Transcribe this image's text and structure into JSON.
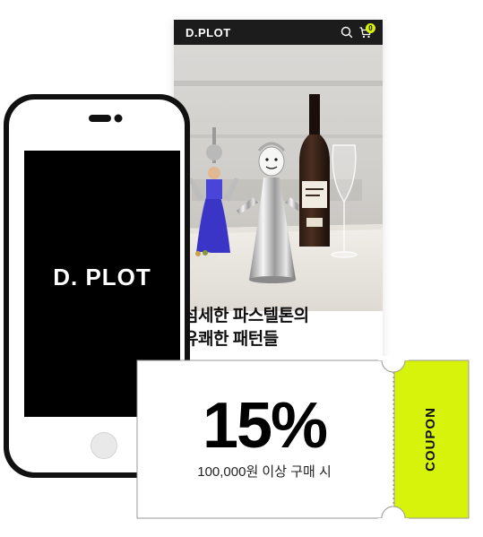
{
  "store": {
    "logo": "D.PLOT",
    "cart_count": "0",
    "hero_text_line1": "섬세한 파스텔톤의",
    "hero_text_line2": "유쾌한 패턴들",
    "icons": [
      "search-icon",
      "cart-icon"
    ]
  },
  "phone": {
    "logo": "D. PLOT"
  },
  "coupon": {
    "value": "15%",
    "condition": "100,000원 이상 구매 시",
    "label": "COUPON",
    "accent_color": "#d7f20b"
  }
}
